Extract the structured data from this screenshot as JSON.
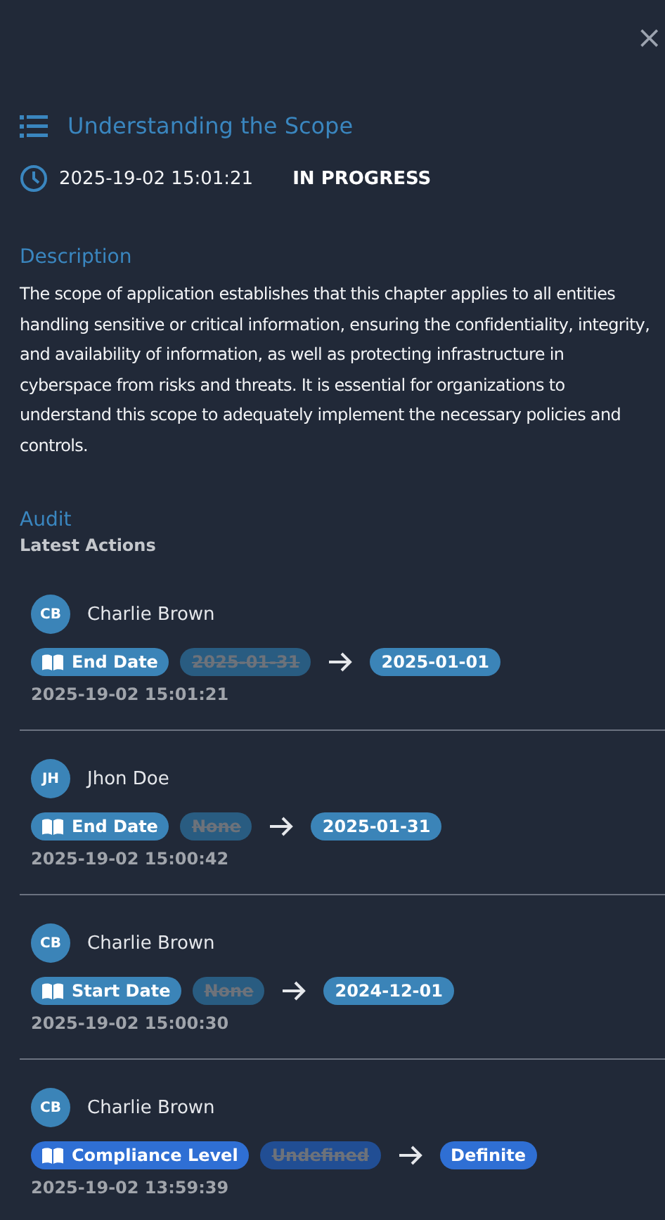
{
  "close_button": "×",
  "title": "Understanding the Scope",
  "meta": {
    "timestamp": "2025-19-02 15:01:21",
    "status": "IN PROGRESS"
  },
  "description": {
    "heading": "Description",
    "text": "The scope of application establishes that this chapter applies to all entities handling sensitive or critical information, ensuring the confidentiality, integrity, and availability of information, as well as protecting infrastructure in cyberspace from risks and threats. It is essential for organizations to understand this scope to adequately implement the necessary policies and controls."
  },
  "audit": {
    "heading": "Audit",
    "subheading": "Latest Actions",
    "actions": [
      {
        "initials": "CB",
        "user": "Charlie Brown",
        "field": "End Date",
        "old_value": "2025-01-31",
        "new_value": "2025-01-01",
        "color": "#3b84b8",
        "time": "2025-19-02 15:01:21"
      },
      {
        "initials": "JH",
        "user": "Jhon Doe",
        "field": "End Date",
        "old_value": "None",
        "new_value": "2025-01-31",
        "color": "#3b84b8",
        "time": "2025-19-02 15:00:42"
      },
      {
        "initials": "CB",
        "user": "Charlie Brown",
        "field": "Start Date",
        "old_value": "None",
        "new_value": "2024-12-01",
        "color": "#3b84b8",
        "time": "2025-19-02 15:00:30"
      },
      {
        "initials": "CB",
        "user": "Charlie Brown",
        "field": "Compliance Level",
        "old_value": "Undefined",
        "new_value": "Definite",
        "color": "#2f6fd4",
        "time": "2025-19-02 13:59:39"
      }
    ]
  }
}
